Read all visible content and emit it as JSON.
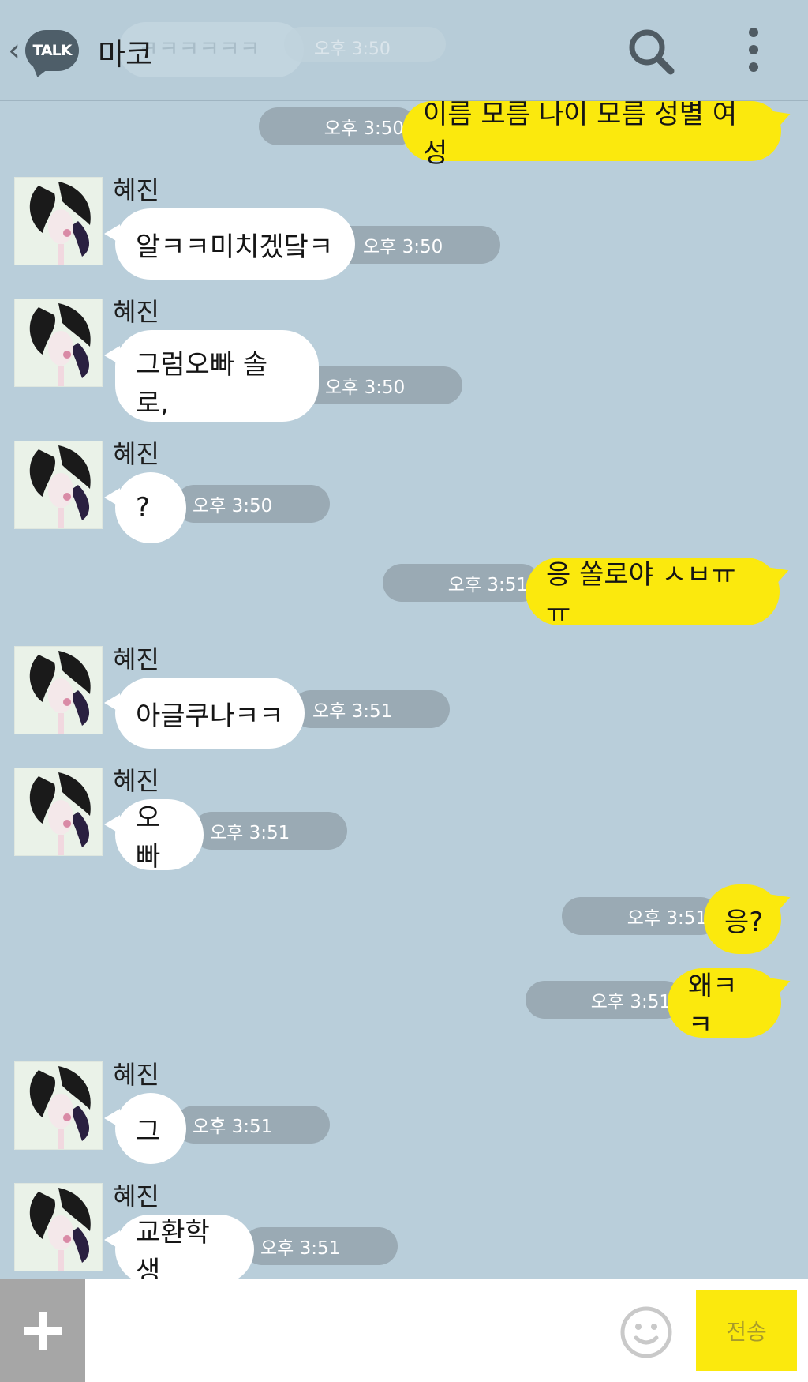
{
  "header": {
    "back_label": "TALK",
    "chat_title": "마코",
    "ghost_text": "ㅋㅋㅋㅋㅋㅋ",
    "ghost_time": "오후 3:50"
  },
  "messages": [
    {
      "sender_type": "me",
      "text": "이름 모름 나이 모름 성별 여성",
      "time": "오후 3:50"
    },
    {
      "sender_type": "other",
      "sender": "혜진",
      "text": "알ㅋㅋ미치겠닼ㅋ",
      "time": "오후 3:50"
    },
    {
      "sender_type": "other",
      "sender": "혜진",
      "text": "그럼오빠 솔로,",
      "time": "오후 3:50"
    },
    {
      "sender_type": "other",
      "sender": "혜진",
      "text": "?",
      "time": "오후 3:50"
    },
    {
      "sender_type": "me",
      "text": "응 쏠로야 ㅅㅂㅠㅠ",
      "time": "오후 3:51"
    },
    {
      "sender_type": "other",
      "sender": "혜진",
      "text": "아글쿠나ㅋㅋ",
      "time": "오후 3:51"
    },
    {
      "sender_type": "other",
      "sender": "혜진",
      "text": "오빠",
      "time": "오후 3:51"
    },
    {
      "sender_type": "me",
      "text": "응?",
      "time": "오후 3:51"
    },
    {
      "sender_type": "me",
      "text": "왜ㅋㅋ",
      "time": "오후 3:51"
    },
    {
      "sender_type": "other",
      "sender": "혜진",
      "text": "그",
      "time": "오후 3:51"
    },
    {
      "sender_type": "other",
      "sender": "혜진",
      "text": "교환학생",
      "time": "오후 3:51"
    }
  ],
  "input": {
    "value": "",
    "send_label": "전송"
  },
  "icons": {
    "back": "chevron-left-icon",
    "search": "search-icon",
    "menu": "more-vertical-icon",
    "attach": "plus-icon",
    "emoji": "smiley-icon"
  },
  "colors": {
    "background": "#b9ceda",
    "my_bubble": "#fbe90d",
    "their_bubble": "#ffffff",
    "time_pill": "#9aaab4",
    "send_button": "#fbe90d"
  }
}
